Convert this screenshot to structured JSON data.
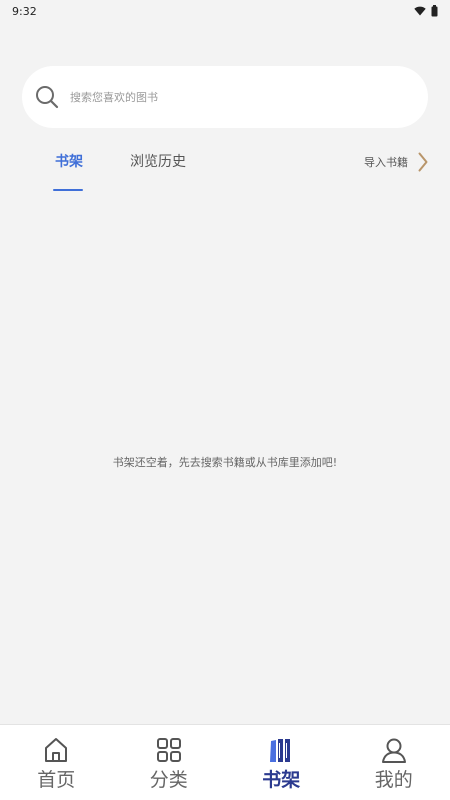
{
  "status_bar": {
    "time": "9:32",
    "icons": [
      "wifi-icon",
      "battery-icon"
    ]
  },
  "search": {
    "placeholder": "搜索您喜欢的图书"
  },
  "tabs": [
    {
      "label": "书架",
      "active": true
    },
    {
      "label": "浏览历史",
      "active": false
    }
  ],
  "import": {
    "label": "导入书籍"
  },
  "empty_state": {
    "message": "书架还空着，先去搜索书籍或从书库里添加吧!"
  },
  "bottom_nav": [
    {
      "label": "首页",
      "icon": "home-icon",
      "active": false
    },
    {
      "label": "分类",
      "icon": "category-grid-icon",
      "active": false
    },
    {
      "label": "书架",
      "icon": "bookshelf-icon",
      "active": true
    },
    {
      "label": "我的",
      "icon": "profile-icon",
      "active": false
    }
  ],
  "colors": {
    "accent": "#3f6fd8",
    "nav_active": "#2b3a8f",
    "background": "#f3f3f3",
    "import_chevron": "#b8956a"
  }
}
